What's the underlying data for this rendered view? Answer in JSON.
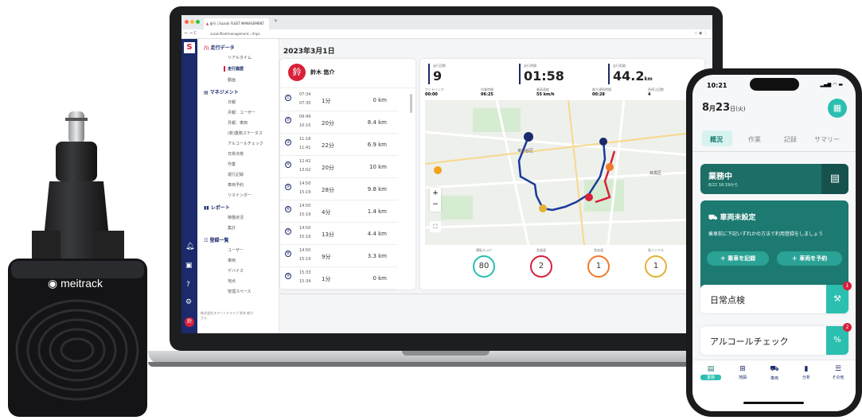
{
  "colors": {
    "navy": "#1a2a6c",
    "teal": "#1c7a72",
    "teal_light": "#2bbfb0",
    "red": "#d9203a",
    "orange": "#ee7a2b",
    "gold": "#e3b234"
  },
  "device": {
    "brand": "meitrack"
  },
  "browser": {
    "tab_title": "走行 | Suzuki FLEET MANAGEMENT",
    "address": "suzukifleetmanagement.../trips"
  },
  "nav": {
    "s1": "走行データ",
    "s1_items": [
      "リアルタイム",
      "走行履歴",
      "動画"
    ],
    "s2": "マネジメント",
    "s2_items": [
      "日報",
      "月報：ユーザー",
      "月報：車両",
      "(新)業務ステータス",
      "アルコールチェック",
      "日常点検",
      "作業",
      "運行記録",
      "車両予約",
      "リマインダー"
    ],
    "s3": "レポート",
    "s3_items": [
      "稼働状況",
      "集計"
    ],
    "s4": "登録一覧",
    "s4_items": [
      "ユーザー",
      "車両",
      "デバイス",
      "地点",
      "管理スペース"
    ],
    "footer": "株式会社スマートドライブ 鈴木 航介さん"
  },
  "main": {
    "date": "2023年3月1日",
    "driver_initial": "鈴",
    "driver_name": "鈴木 悠介"
  },
  "trips": [
    {
      "n": "①",
      "start": "07:34",
      "end": "07:35",
      "dur": "1分",
      "dist": "0 km"
    },
    {
      "n": "②",
      "start": "09:49",
      "end": "10:10",
      "dur": "20分",
      "dist": "8.4 km"
    },
    {
      "n": "③",
      "start": "11:18",
      "end": "11:41",
      "dur": "22分",
      "dist": "6.9 km"
    },
    {
      "n": "④",
      "start": "12:42",
      "end": "13:02",
      "dur": "20分",
      "dist": "10 km"
    },
    {
      "n": "⑤",
      "start": "14:50",
      "end": "15:19",
      "dur": "28分",
      "dist": "9.8 km"
    },
    {
      "n": "⑥",
      "start": "14:50",
      "end": "15:19",
      "dur": "4分",
      "dist": "1.4 km"
    },
    {
      "n": "⑦",
      "start": "14:50",
      "end": "15:19",
      "dur": "13分",
      "dist": "4.4 km"
    },
    {
      "n": "⑧",
      "start": "14:50",
      "end": "15:19",
      "dur": "9分",
      "dist": "3.3 km"
    },
    {
      "n": "⑨",
      "start": "15:33",
      "end": "15:34",
      "dur": "1分",
      "dist": "0 km"
    }
  ],
  "stats": {
    "trips_label": "走行回数",
    "trips": "9",
    "time_label": "走行時間",
    "time": "01:58",
    "dist_label": "走行距離",
    "dist": "44.2",
    "dist_unit": "km",
    "idle_label": "アイドリング",
    "idle": "00:00",
    "work_label": "作業時間",
    "work": "06:25",
    "speed_label": "最高速度",
    "speed": "55 km/h",
    "cont_label": "最大連続時間",
    "cont": "00:28",
    "stop_label": "急停止回数",
    "stop": "4"
  },
  "map": {
    "label1": "世田谷区",
    "label2": "目黒区"
  },
  "scores": [
    {
      "label": "運転スコア",
      "value": "80",
      "color": "#2bbfb0"
    },
    {
      "label": "急減速",
      "value": "2",
      "color": "#d9203a"
    },
    {
      "label": "急加速",
      "value": "1",
      "color": "#ee7a2b"
    },
    {
      "label": "急ハンドル",
      "value": "1",
      "color": "#e3b234"
    }
  ],
  "phone": {
    "time": "10:21",
    "date_month": "8",
    "date_day": "23",
    "date_rest": "日(火)",
    "tabs": [
      "概況",
      "作業",
      "記録",
      "サマリー"
    ],
    "status_title": "業務中",
    "status_sub": "8/22 16:19から",
    "vehicle_title": "車両未設定",
    "vehicle_desc": "乗車前に下記いずれかの方法で利用登録をしましょう",
    "btn1": "乗車を記録",
    "btn2": "車両を予約",
    "inspection": "日常点検",
    "inspection_badge": "1",
    "alcohol": "アルコールチェック",
    "alcohol_badge": "2",
    "bottom_nav": [
      "業務",
      "地図",
      "車両",
      "分析",
      "その他"
    ]
  }
}
